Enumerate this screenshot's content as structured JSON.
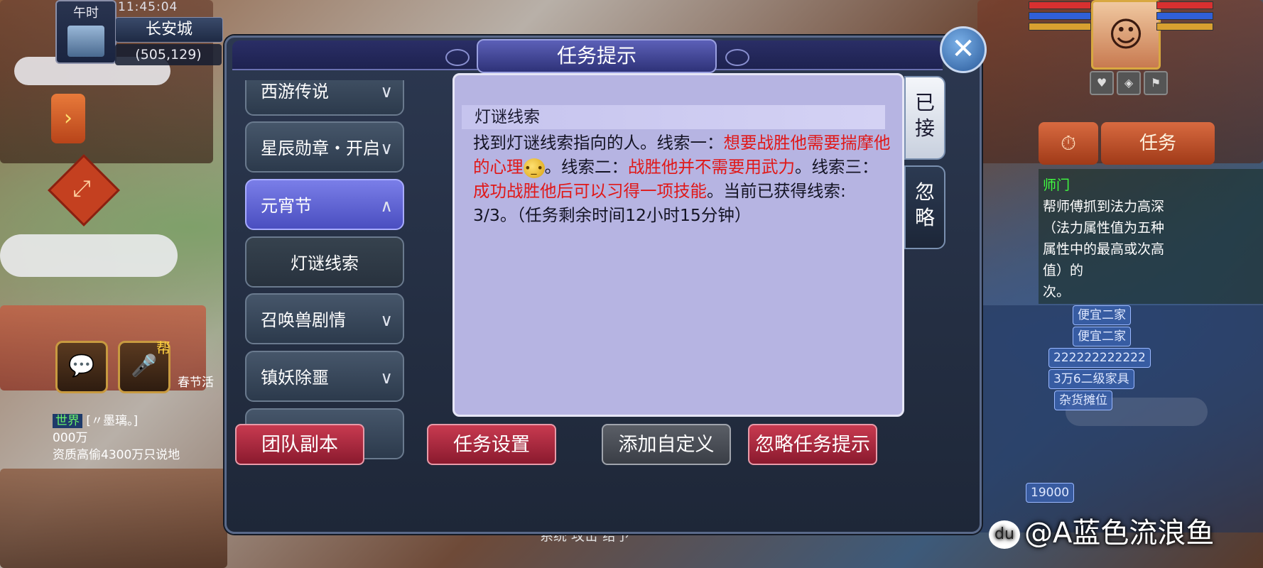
{
  "hud": {
    "time_label": "午时",
    "clock": "11:45:04",
    "city": "长安城",
    "coords": "(505,129)"
  },
  "dialog": {
    "title": "任务提示",
    "close_glyph": "✕",
    "categories": [
      {
        "label": "西游传说",
        "chevron": "⌄"
      },
      {
        "label": "星辰勋章・开启",
        "chevron": "⌄"
      },
      {
        "label": "元宵节",
        "chevron": "⌃"
      },
      {
        "label": "灯谜线索",
        "chevron": ""
      },
      {
        "label": "召唤兽剧情",
        "chevron": "⌄"
      },
      {
        "label": "镇妖除噩",
        "chevron": "⌄"
      }
    ],
    "content": {
      "title": "灯谜线索",
      "line_intro": "找到灯谜线索指向的人。线索一：",
      "clue1": "想要战胜他需要揣摩他的心理",
      "emoji": "😓",
      "sep1": "。线索二：",
      "clue2": "战胜他并不需要用武力",
      "sep2": "。线索三：",
      "clue3": "成功战胜他后可以习得一项技能",
      "tail": "。当前已获得线索: 3/3。（任务剩余时间12小时15分钟）"
    },
    "tabs": {
      "accepted": "已接",
      "ignore": "忽略"
    },
    "footer": {
      "team_dungeon": "团队副本",
      "task_settings": "任务设置",
      "add_custom": "添加自定义",
      "ignore_hint": "忽略任务提示"
    }
  },
  "right_hud": {
    "task_button": "任务",
    "timer_icon": "⏱",
    "tracker": [
      {
        "text": "师门",
        "color": "#40ff40"
      },
      {
        "text": "帮师傅抓到法力高深",
        "color": "#ffffff"
      },
      {
        "text": "（法力属性值为五种",
        "color": "#ffffff"
      },
      {
        "text": "属性中的最高或次高",
        "color": "#ffffff"
      },
      {
        "text": "值）的",
        "color": "#ffffff"
      },
      {
        "text": "次。",
        "color": "#ffffff"
      }
    ],
    "list_items": [
      "便宜二家",
      "便宜二家",
      "222222222222",
      "3万6二级家具",
      "杂货摊位",
      "19000"
    ]
  },
  "chat": {
    "channel": "世界",
    "line1": "[〃墨璃。]",
    "line2": "000万",
    "line3": "资质高偷4300万只说地",
    "event_label": "春节活",
    "gang_label": "帮"
  },
  "bottom_bar": "系统    攻击    给予",
  "watermark": "@A蓝色流浪鱼",
  "watermark_icon": "du",
  "colors": {
    "dialog_bg": "#1e2738",
    "active_tab": "#5a5ed0",
    "content_bg": "#b6b4e2",
    "clue_red": "#e01818",
    "footer_red": "#a02238"
  }
}
